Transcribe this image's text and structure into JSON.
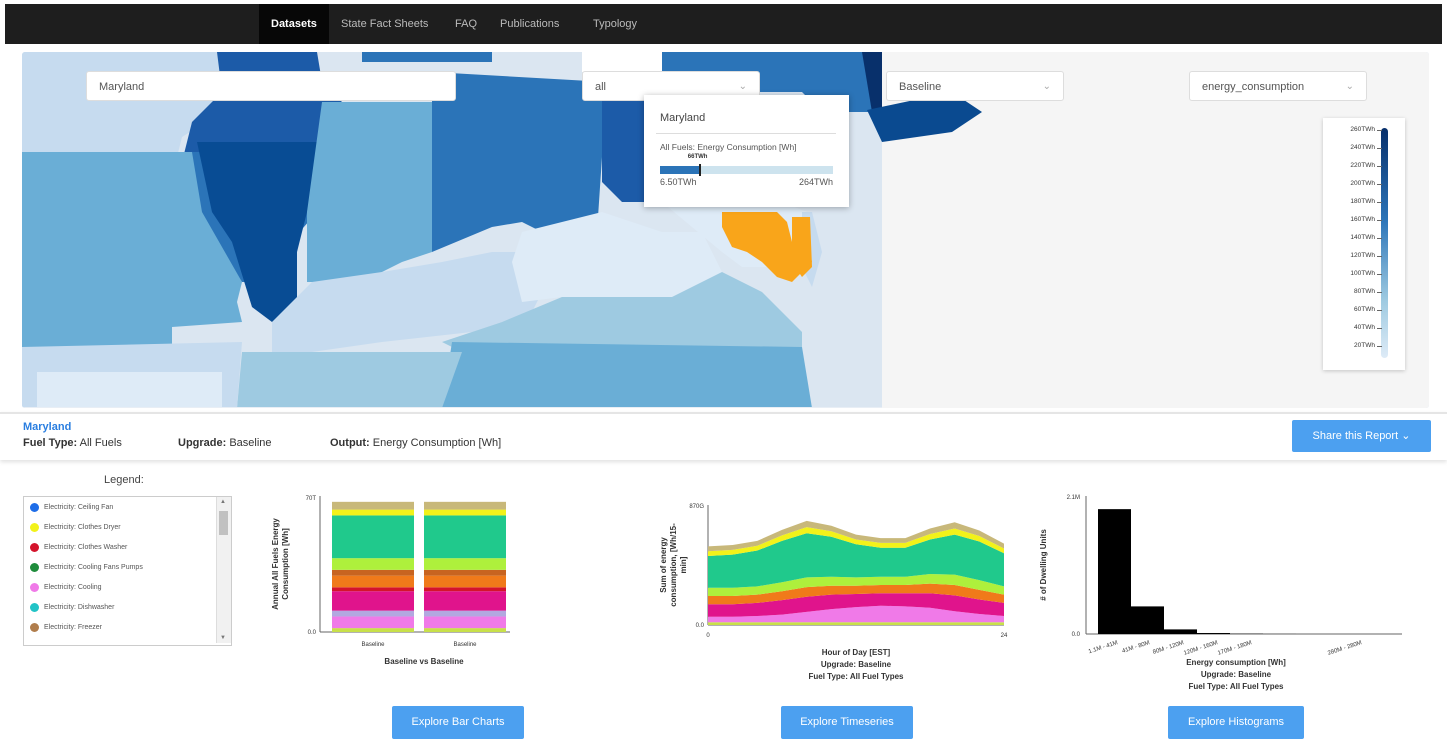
{
  "nav": {
    "items": [
      "Datasets",
      "State Fact Sheets",
      "FAQ",
      "Publications",
      "Typology"
    ],
    "active": "Datasets"
  },
  "filters": {
    "state": "Maryland",
    "fuel": "all",
    "upgrade": "Baseline",
    "output": "energy_consumption"
  },
  "tooltip": {
    "state": "Maryland",
    "label": "All Fuels: Energy Consumption [Wh]",
    "value": "66TWh",
    "min": "6.50TWh",
    "max": "264TWh",
    "fraction": 0.23
  },
  "color_legend": {
    "ticks": [
      "260TWh",
      "240TWh",
      "220TWh",
      "200TWh",
      "180TWh",
      "160TWh",
      "140TWh",
      "120TWh",
      "100TWh",
      "80TWh",
      "60TWh",
      "40TWh",
      "20TWh"
    ],
    "colors": [
      "#08306b",
      "#deebf7"
    ]
  },
  "summary": {
    "state": "Maryland",
    "fuel_label": "Fuel Type:",
    "fuel_value": "All Fuels",
    "upgrade_label": "Upgrade:",
    "upgrade_value": "Baseline",
    "output_label": "Output:",
    "output_value": "Energy Consumption [Wh]",
    "share": "Share this Report"
  },
  "legend": {
    "title": "Legend:",
    "items": [
      {
        "label": "Electricity: Ceiling Fan",
        "color": "#1e6de8"
      },
      {
        "label": "Electricity: Clothes Dryer",
        "color": "#f2f21a"
      },
      {
        "label": "Electricity: Clothes Washer",
        "color": "#d4142c"
      },
      {
        "label": "Electricity: Cooling Fans Pumps",
        "color": "#1f8c3c"
      },
      {
        "label": "Electricity: Cooling",
        "color": "#f07ae8"
      },
      {
        "label": "Electricity: Dishwasher",
        "color": "#22c3c6"
      },
      {
        "label": "Electricity: Freezer",
        "color": "#b07d4c"
      }
    ]
  },
  "buttons": {
    "bar": "Explore Bar Charts",
    "timeseries": "Explore Timeseries",
    "histogram": "Explore Histograms"
  },
  "chart_data": [
    {
      "type": "bar",
      "stacked": true,
      "categories": [
        "Baseline",
        "Baseline"
      ],
      "ylabel": "Annual All Fuels Energy Consumption [Wh]",
      "yticks": [
        "70T",
        "0.0"
      ],
      "ylim": [
        0,
        70
      ],
      "xlabel": "Baseline vs Baseline",
      "series": [
        {
          "color": "#c8e04a",
          "values": [
            2,
            2
          ]
        },
        {
          "color": "#f07ae8",
          "values": [
            6,
            6
          ]
        },
        {
          "color": "#b3a8e0",
          "values": [
            3,
            3
          ]
        },
        {
          "color": "#e0148c",
          "values": [
            10,
            10
          ]
        },
        {
          "color": "#d4142c",
          "values": [
            2,
            2
          ]
        },
        {
          "color": "#f07a1a",
          "values": [
            6,
            6
          ]
        },
        {
          "color": "#c86420",
          "values": [
            3,
            3
          ]
        },
        {
          "color": "#aef03c",
          "values": [
            6,
            6
          ]
        },
        {
          "color": "#20c98c",
          "values": [
            22,
            22
          ]
        },
        {
          "color": "#f2f21a",
          "values": [
            3,
            3
          ]
        },
        {
          "color": "#c8b87a",
          "values": [
            4,
            4
          ]
        }
      ]
    },
    {
      "type": "area",
      "stacked": true,
      "x": [
        0,
        2,
        4,
        6,
        8,
        10,
        12,
        14,
        16,
        18,
        20,
        22,
        24
      ],
      "xticks": [
        "0",
        "24"
      ],
      "yticks": [
        "870G",
        "0.0"
      ],
      "ylim": [
        0,
        870
      ],
      "ylabel": "Sum of energy consumption, [Wh/15-min]",
      "xlabel": "Hour of Day [EST]",
      "caption1": "Upgrade: Baseline",
      "caption2": "Fuel Type: All Fuel Types",
      "series": [
        {
          "color": "#c8e04a",
          "values": [
            20,
            20,
            20,
            20,
            20,
            20,
            20,
            20,
            20,
            20,
            20,
            20,
            20
          ]
        },
        {
          "color": "#f07ae8",
          "values": [
            40,
            40,
            45,
            55,
            75,
            95,
            110,
            120,
            115,
            105,
            80,
            60,
            45
          ]
        },
        {
          "color": "#e0148c",
          "values": [
            90,
            90,
            95,
            105,
            110,
            105,
            95,
            90,
            95,
            105,
            115,
            105,
            95
          ]
        },
        {
          "color": "#f07a1a",
          "values": [
            60,
            60,
            60,
            65,
            70,
            65,
            60,
            60,
            60,
            70,
            75,
            70,
            60
          ]
        },
        {
          "color": "#aef03c",
          "values": [
            60,
            60,
            60,
            65,
            70,
            65,
            60,
            60,
            60,
            70,
            75,
            70,
            60
          ]
        },
        {
          "color": "#20c98c",
          "values": [
            230,
            240,
            260,
            300,
            320,
            290,
            240,
            210,
            210,
            250,
            290,
            280,
            240
          ]
        },
        {
          "color": "#f2f21a",
          "values": [
            35,
            35,
            35,
            40,
            45,
            40,
            35,
            35,
            35,
            40,
            45,
            40,
            35
          ]
        },
        {
          "color": "#c8b87a",
          "values": [
            35,
            35,
            35,
            40,
            45,
            40,
            35,
            35,
            35,
            40,
            45,
            40,
            35
          ]
        }
      ]
    },
    {
      "type": "bar",
      "categories": [
        "1.1M - 41M",
        "41M - 80M",
        "80M - 120M",
        "120M - 160M",
        "170M - 180M",
        "280M - 280M"
      ],
      "values": [
        1900000,
        420000,
        70000,
        15000,
        5000,
        1000
      ],
      "yticks": [
        "2.1M",
        "0.0"
      ],
      "ylim": [
        0,
        2100000
      ],
      "ylabel": "# of Dwelling Units",
      "xlabel": "Energy consumption [Wh]",
      "caption1": "Upgrade: Baseline",
      "caption2": "Fuel Type: All Fuel Types"
    }
  ]
}
